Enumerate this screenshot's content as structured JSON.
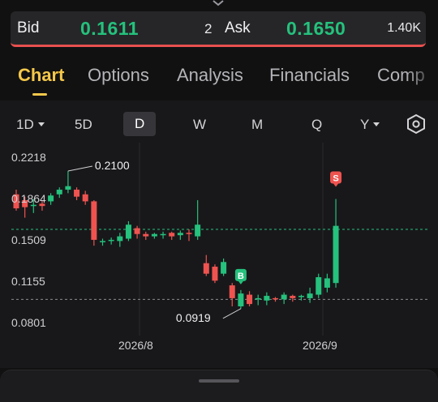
{
  "quote": {
    "bid_label": "Bid",
    "bid_price": "0.1611",
    "bid_size": "2",
    "ask_label": "Ask",
    "ask_price": "0.1650",
    "ask_size": "1.40K"
  },
  "tabs": [
    "Chart",
    "Options",
    "Analysis",
    "Financials",
    "Comp"
  ],
  "active_tab": "Chart",
  "periods": [
    "1D",
    "5D",
    "D",
    "W",
    "M",
    "Q",
    "Y"
  ],
  "active_period": "D",
  "icons": {
    "top": "chevron-down-icon",
    "settings": "settings-hexagon-icon"
  },
  "colors": {
    "up": "#25c17d",
    "down": "#ef5350",
    "accent": "#f5c84a"
  },
  "chart_data": {
    "type": "candlestick",
    "y_ticks": [
      "0.2218",
      "0.1864",
      "0.1509",
      "0.1155",
      "0.0801"
    ],
    "x_ticks": [
      "2026/8",
      "2026/9"
    ],
    "annotations": {
      "high": "0.2100",
      "low": "0.0919"
    },
    "markers": {
      "buy": "B",
      "sell": "S"
    },
    "reference_lines": {
      "current_price": 0.16,
      "low_line": 0.1
    },
    "candles": [
      {
        "o": 0.19,
        "c": 0.178,
        "h": 0.194,
        "l": 0.176
      },
      {
        "o": 0.185,
        "c": 0.179,
        "h": 0.188,
        "l": 0.17
      },
      {
        "o": 0.181,
        "c": 0.181,
        "h": 0.186,
        "l": 0.174
      },
      {
        "o": 0.182,
        "c": 0.18,
        "h": 0.185,
        "l": 0.176
      },
      {
        "o": 0.184,
        "c": 0.189,
        "h": 0.191,
        "l": 0.181
      },
      {
        "o": 0.19,
        "c": 0.194,
        "h": 0.196,
        "l": 0.187
      },
      {
        "o": 0.194,
        "c": 0.197,
        "h": 0.21,
        "l": 0.191
      },
      {
        "o": 0.194,
        "c": 0.188,
        "h": 0.196,
        "l": 0.185
      },
      {
        "o": 0.19,
        "c": 0.184,
        "h": 0.193,
        "l": 0.181
      },
      {
        "o": 0.184,
        "c": 0.151,
        "h": 0.185,
        "l": 0.146
      },
      {
        "o": 0.149,
        "c": 0.15,
        "h": 0.152,
        "l": 0.146
      },
      {
        "o": 0.15,
        "c": 0.151,
        "h": 0.153,
        "l": 0.147
      },
      {
        "o": 0.15,
        "c": 0.154,
        "h": 0.157,
        "l": 0.145
      },
      {
        "o": 0.152,
        "c": 0.164,
        "h": 0.167,
        "l": 0.15
      },
      {
        "o": 0.161,
        "c": 0.156,
        "h": 0.163,
        "l": 0.152
      },
      {
        "o": 0.156,
        "c": 0.154,
        "h": 0.158,
        "l": 0.151
      },
      {
        "o": 0.154,
        "c": 0.156,
        "h": 0.157,
        "l": 0.152
      },
      {
        "o": 0.156,
        "c": 0.156,
        "h": 0.158,
        "l": 0.152
      },
      {
        "o": 0.157,
        "c": 0.154,
        "h": 0.158,
        "l": 0.151
      },
      {
        "o": 0.155,
        "c": 0.157,
        "h": 0.159,
        "l": 0.151
      },
      {
        "o": 0.157,
        "c": 0.156,
        "h": 0.16,
        "l": 0.15
      },
      {
        "o": 0.154,
        "c": 0.164,
        "h": 0.185,
        "l": 0.151
      },
      {
        "o": 0.131,
        "c": 0.122,
        "h": 0.138,
        "l": 0.12
      },
      {
        "o": 0.128,
        "c": 0.116,
        "h": 0.13,
        "l": 0.114
      },
      {
        "o": 0.122,
        "c": 0.132,
        "h": 0.135,
        "l": 0.12
      },
      {
        "o": 0.112,
        "c": 0.101,
        "h": 0.114,
        "l": 0.094
      },
      {
        "o": 0.094,
        "c": 0.105,
        "h": 0.108,
        "l": 0.092
      },
      {
        "o": 0.104,
        "c": 0.096,
        "h": 0.107,
        "l": 0.094
      },
      {
        "o": 0.1,
        "c": 0.101,
        "h": 0.104,
        "l": 0.095
      },
      {
        "o": 0.099,
        "c": 0.103,
        "h": 0.106,
        "l": 0.095
      },
      {
        "o": 0.101,
        "c": 0.1,
        "h": 0.102,
        "l": 0.098
      },
      {
        "o": 0.1,
        "c": 0.104,
        "h": 0.106,
        "l": 0.096
      },
      {
        "o": 0.103,
        "c": 0.101,
        "h": 0.104,
        "l": 0.098
      },
      {
        "o": 0.102,
        "c": 0.103,
        "h": 0.104,
        "l": 0.099
      },
      {
        "o": 0.101,
        "c": 0.105,
        "h": 0.11,
        "l": 0.097
      },
      {
        "o": 0.104,
        "c": 0.119,
        "h": 0.122,
        "l": 0.101
      },
      {
        "o": 0.11,
        "c": 0.118,
        "h": 0.122,
        "l": 0.106
      },
      {
        "o": 0.114,
        "c": 0.163,
        "h": 0.186,
        "l": 0.11
      }
    ]
  }
}
